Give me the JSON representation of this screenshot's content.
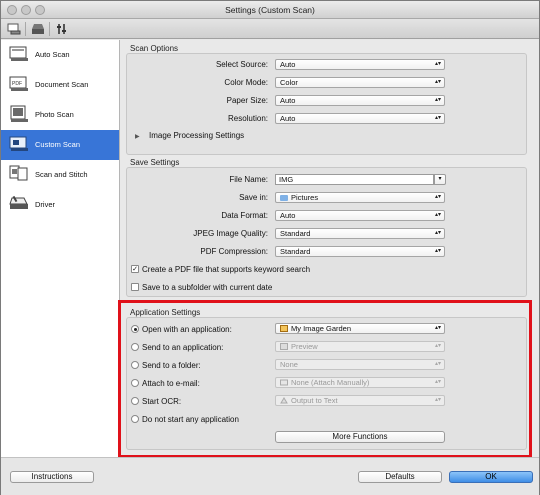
{
  "window": {
    "title": "Settings (Custom Scan)"
  },
  "sidebar": {
    "items": [
      {
        "label": "Auto Scan",
        "icon": "auto-scan-icon"
      },
      {
        "label": "Document Scan",
        "icon": "document-scan-icon"
      },
      {
        "label": "Photo Scan",
        "icon": "photo-scan-icon"
      },
      {
        "label": "Custom Scan",
        "icon": "custom-scan-icon",
        "selected": true
      },
      {
        "label": "Scan and Stitch",
        "icon": "scan-stitch-icon"
      },
      {
        "label": "Driver",
        "icon": "driver-icon"
      }
    ]
  },
  "scan_options": {
    "title": "Scan Options",
    "select_source": {
      "label": "Select Source:",
      "value": "Auto"
    },
    "color_mode": {
      "label": "Color Mode:",
      "value": "Color"
    },
    "paper_size": {
      "label": "Paper Size:",
      "value": "Auto"
    },
    "resolution": {
      "label": "Resolution:",
      "value": "Auto"
    },
    "image_processing": "Image Processing Settings"
  },
  "save_settings": {
    "title": "Save Settings",
    "file_name": {
      "label": "File Name:",
      "value": "IMG"
    },
    "save_in": {
      "label": "Save in:",
      "value": "Pictures"
    },
    "data_format": {
      "label": "Data Format:",
      "value": "Auto"
    },
    "jpeg_quality": {
      "label": "JPEG Image Quality:",
      "value": "Standard"
    },
    "pdf_compression": {
      "label": "PDF Compression:",
      "value": "Standard"
    },
    "keyword_search": {
      "label": "Create a PDF file that supports keyword search",
      "checked": true
    },
    "subfolder": {
      "label": "Save to a subfolder with current date",
      "checked": false
    }
  },
  "application_settings": {
    "title": "Application Settings",
    "open_with": {
      "label": "Open with an application:",
      "value": "My Image Garden",
      "selected": true
    },
    "send_to_app": {
      "label": "Send to an application:",
      "value": "Preview"
    },
    "send_to_folder": {
      "label": "Send to a folder:",
      "value": "None"
    },
    "attach_email": {
      "label": "Attach to e-mail:",
      "value": "None (Attach Manually)"
    },
    "start_ocr": {
      "label": "Start OCR:",
      "value": "Output to Text"
    },
    "do_not_start": {
      "label": "Do not start any application"
    },
    "more_functions": "More Functions"
  },
  "footer": {
    "instructions": "Instructions",
    "defaults": "Defaults",
    "ok": "OK"
  },
  "colors": {
    "selection": "#3875d7",
    "highlight_border": "#e0111a",
    "ok_button": "#3f8ee6"
  }
}
